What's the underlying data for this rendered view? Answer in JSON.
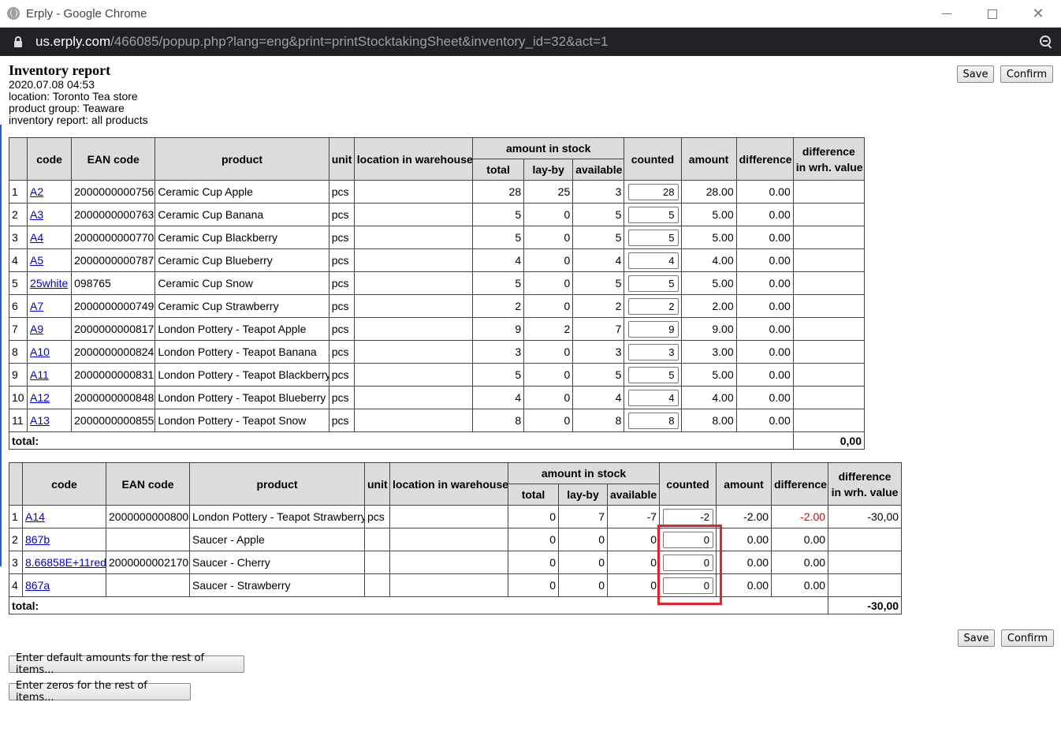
{
  "window": {
    "title": "Erply - Google Chrome",
    "url_host": "us.erply.com",
    "url_path": "/466085/popup.php?lang=eng&print=printStocktakingSheet&inventory_id=32&act=1"
  },
  "report": {
    "title": "Inventory report",
    "date": "2020.07.08 04:53",
    "location": "location: Toronto Tea store",
    "product_group": "product group: Teaware",
    "inventory_scope": "inventory report: all products"
  },
  "buttons": {
    "save": "Save",
    "confirm": "Confirm",
    "enter_defaults": "Enter default amounts for the rest of items...",
    "enter_zeros": "Enter zeros for the rest of items..."
  },
  "columns": {
    "code": "code",
    "ean": "EAN code",
    "product": "product",
    "unit": "unit",
    "location": "location in warehouse",
    "amount_in_stock": "amount in stock",
    "total": "total",
    "layby": "lay-by",
    "available": "available",
    "counted": "counted",
    "amount": "amount",
    "difference": "difference",
    "diff_value_1": "difference",
    "diff_value_2": "in wrh. value"
  },
  "table1": {
    "rows": [
      {
        "n": "1",
        "code": "A2",
        "ean": "2000000000756",
        "product": "Ceramic Cup Apple",
        "unit": "pcs",
        "location": "",
        "total": "28",
        "layby": "25",
        "available": "3",
        "counted": "28",
        "amount": "28.00",
        "difference": "0.00",
        "value": ""
      },
      {
        "n": "2",
        "code": "A3",
        "ean": "2000000000763",
        "product": "Ceramic Cup Banana",
        "unit": "pcs",
        "location": "",
        "total": "5",
        "layby": "0",
        "available": "5",
        "counted": "5",
        "amount": "5.00",
        "difference": "0.00",
        "value": ""
      },
      {
        "n": "3",
        "code": "A4",
        "ean": "2000000000770",
        "product": "Ceramic Cup Blackberry",
        "unit": "pcs",
        "location": "",
        "total": "5",
        "layby": "0",
        "available": "5",
        "counted": "5",
        "amount": "5.00",
        "difference": "0.00",
        "value": ""
      },
      {
        "n": "4",
        "code": "A5",
        "ean": "2000000000787",
        "product": "Ceramic Cup Blueberry",
        "unit": "pcs",
        "location": "",
        "total": "4",
        "layby": "0",
        "available": "4",
        "counted": "4",
        "amount": "4.00",
        "difference": "0.00",
        "value": ""
      },
      {
        "n": "5",
        "code": "25white",
        "ean": "098765",
        "product": "Ceramic Cup Snow",
        "unit": "pcs",
        "location": "",
        "total": "5",
        "layby": "0",
        "available": "5",
        "counted": "5",
        "amount": "5.00",
        "difference": "0.00",
        "value": ""
      },
      {
        "n": "6",
        "code": "A7",
        "ean": "2000000000749",
        "product": "Ceramic Cup Strawberry",
        "unit": "pcs",
        "location": "",
        "total": "2",
        "layby": "0",
        "available": "2",
        "counted": "2",
        "amount": "2.00",
        "difference": "0.00",
        "value": ""
      },
      {
        "n": "7",
        "code": "A9",
        "ean": "2000000000817",
        "product": "London Pottery - Teapot Apple",
        "unit": "pcs",
        "location": "",
        "total": "9",
        "layby": "2",
        "available": "7",
        "counted": "9",
        "amount": "9.00",
        "difference": "0.00",
        "value": ""
      },
      {
        "n": "8",
        "code": "A10",
        "ean": "2000000000824",
        "product": "London Pottery - Teapot Banana",
        "unit": "pcs",
        "location": "",
        "total": "3",
        "layby": "0",
        "available": "3",
        "counted": "3",
        "amount": "3.00",
        "difference": "0.00",
        "value": ""
      },
      {
        "n": "9",
        "code": "A11",
        "ean": "2000000000831",
        "product": "London Pottery - Teapot Blackberry",
        "unit": "pcs",
        "location": "",
        "total": "5",
        "layby": "0",
        "available": "5",
        "counted": "5",
        "amount": "5.00",
        "difference": "0.00",
        "value": ""
      },
      {
        "n": "10",
        "code": "A12",
        "ean": "2000000000848",
        "product": "London Pottery - Teapot Blueberry",
        "unit": "pcs",
        "location": "",
        "total": "4",
        "layby": "0",
        "available": "4",
        "counted": "4",
        "amount": "4.00",
        "difference": "0.00",
        "value": ""
      },
      {
        "n": "11",
        "code": "A13",
        "ean": "2000000000855",
        "product": "London Pottery - Teapot Snow",
        "unit": "pcs",
        "location": "",
        "total": "8",
        "layby": "0",
        "available": "8",
        "counted": "8",
        "amount": "8.00",
        "difference": "0.00",
        "value": ""
      }
    ],
    "total_label": "total:",
    "total_value": "0,00"
  },
  "table2": {
    "rows": [
      {
        "n": "1",
        "code": "A14",
        "ean": "2000000000800",
        "product": "London Pottery - Teapot Strawberry",
        "unit": "pcs",
        "location": "",
        "total": "0",
        "layby": "7",
        "available": "-7",
        "counted": "-2",
        "amount": "-2.00",
        "difference": "-2.00",
        "value": "-30,00",
        "diff_negative": true
      },
      {
        "n": "2",
        "code": "867b",
        "ean": "",
        "product": "Saucer - Apple",
        "unit": "",
        "location": "",
        "total": "0",
        "layby": "0",
        "available": "0",
        "counted": "0",
        "amount": "0.00",
        "difference": "0.00",
        "value": "",
        "diff_negative": false
      },
      {
        "n": "3",
        "code": "8.66858E+11red",
        "ean": "2000000002170",
        "product": "Saucer - Cherry",
        "unit": "",
        "location": "",
        "total": "0",
        "layby": "0",
        "available": "0",
        "counted": "0",
        "amount": "0.00",
        "difference": "0.00",
        "value": "",
        "diff_negative": false
      },
      {
        "n": "4",
        "code": "867a",
        "ean": "",
        "product": "Saucer - Strawberry",
        "unit": "",
        "location": "",
        "total": "0",
        "layby": "0",
        "available": "0",
        "counted": "0",
        "amount": "0.00",
        "difference": "0.00",
        "value": "",
        "diff_negative": false
      }
    ],
    "total_label": "total:",
    "total_value": "-30,00"
  },
  "colors": {
    "link": "#0000cc",
    "negative": "#e00000",
    "highlight": "#e0242d",
    "header_bg": "#dcdcdc"
  }
}
